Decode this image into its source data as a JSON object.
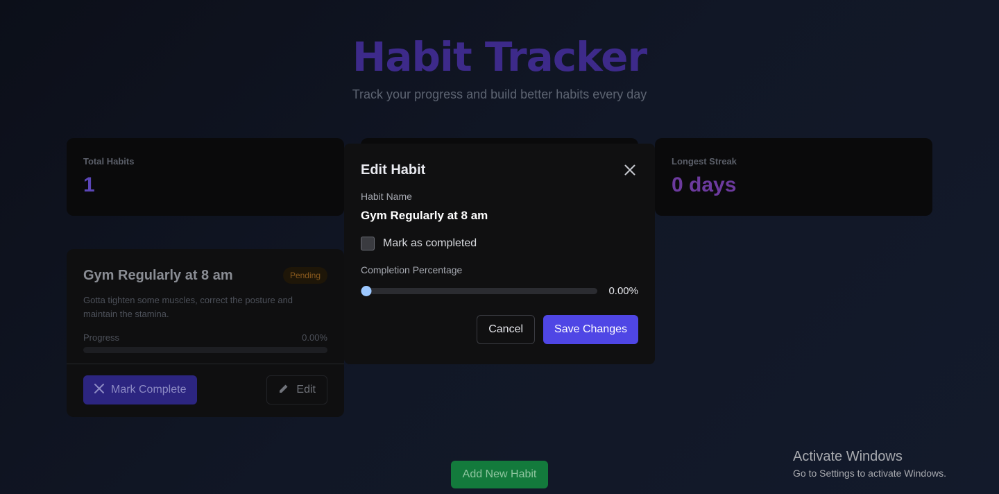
{
  "header": {
    "title": "Habit Tracker",
    "subtitle": "Track your progress and build better habits every day"
  },
  "stats": {
    "total": {
      "label": "Total Habits",
      "value": "1",
      "color": "#5b46b8"
    },
    "longest": {
      "label": "Longest Streak",
      "value": "0 days",
      "color": "#6c3a9e"
    }
  },
  "habit": {
    "name": "Gym Regularly at 8 am",
    "status": "Pending",
    "description": "Gotta tighten some muscles, correct the posture and maintain the stamina.",
    "progress_label": "Progress",
    "progress_text": "0.00%",
    "progress_fraction": 0,
    "mark_complete_label": "Mark Complete",
    "edit_label": "Edit"
  },
  "modal": {
    "title": "Edit Habit",
    "name_label": "Habit Name",
    "name_value": "Gym Regularly at 8 am",
    "checkbox_label": "Mark as completed",
    "checked": false,
    "percent_label": "Completion Percentage",
    "percent_text": "0.00%",
    "percent_fraction": 0,
    "cancel_label": "Cancel",
    "save_label": "Save Changes"
  },
  "add_button_label": "Add New Habit",
  "watermark": {
    "title": "Activate Windows",
    "subtitle": "Go to Settings to activate Windows."
  }
}
